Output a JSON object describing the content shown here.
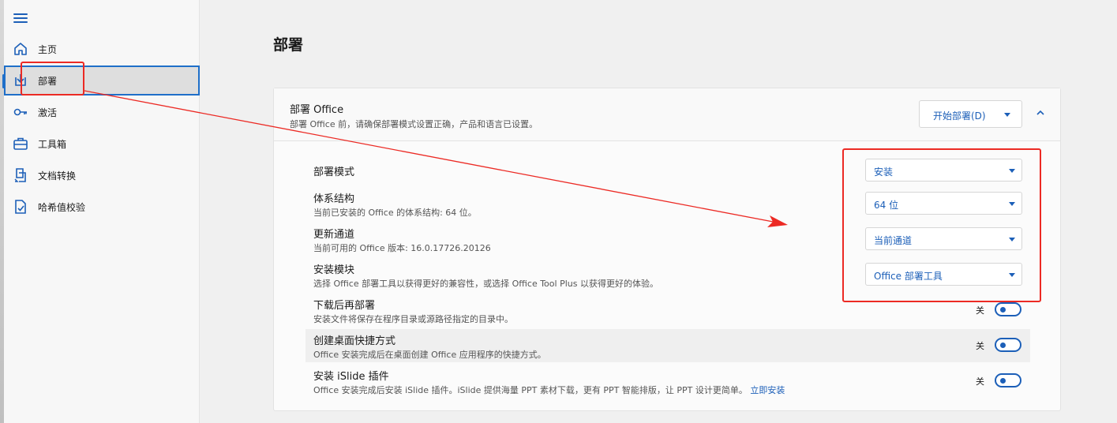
{
  "sidebar": {
    "items": [
      {
        "label": "主页",
        "icon": "home-icon"
      },
      {
        "label": "部署",
        "icon": "download-icon"
      },
      {
        "label": "激活",
        "icon": "key-icon"
      },
      {
        "label": "工具箱",
        "icon": "toolbox-icon"
      },
      {
        "label": "文档转换",
        "icon": "document-convert-icon"
      },
      {
        "label": "哈希值校验",
        "icon": "file-check-icon"
      }
    ],
    "active_index": 1
  },
  "main": {
    "title": "部署",
    "card": {
      "title": "部署 Office",
      "subtitle": "部署 Office 前，请确保部署模式设置正确，产品和语言已设置。",
      "deploy_button": "开始部署(D)",
      "rows": [
        {
          "label": "部署模式",
          "desc": "",
          "value": "安装"
        },
        {
          "label": "体系结构",
          "desc": "当前已安装的 Office 的体系结构: 64 位。",
          "value": "64 位"
        },
        {
          "label": "更新通道",
          "desc": "当前可用的 Office 版本: 16.0.17726.20126",
          "value": "当前通道"
        },
        {
          "label": "安装模块",
          "desc": "选择 Office 部署工具以获得更好的兼容性，或选择 Office Tool Plus 以获得更好的体验。",
          "value": "Office 部署工具"
        }
      ],
      "toggles": [
        {
          "label": "下载后再部署",
          "desc": "安装文件将保存在程序目录或源路径指定的目录中。",
          "state": "关"
        },
        {
          "label": "创建桌面快捷方式",
          "desc": "Office 安装完成后在桌面创建 Office 应用程序的快捷方式。",
          "state": "关"
        },
        {
          "label": "安装 iSlide 插件",
          "desc": "Office 安装完成后安装 iSlide 插件。iSlide 提供海量 PPT 素材下载，更有 PPT 智能排版，让 PPT 设计更简单。",
          "link": "立即安装",
          "state": "关"
        }
      ]
    }
  },
  "colors": {
    "accent": "#1c5fb8",
    "annotation": "#ec2a24"
  }
}
